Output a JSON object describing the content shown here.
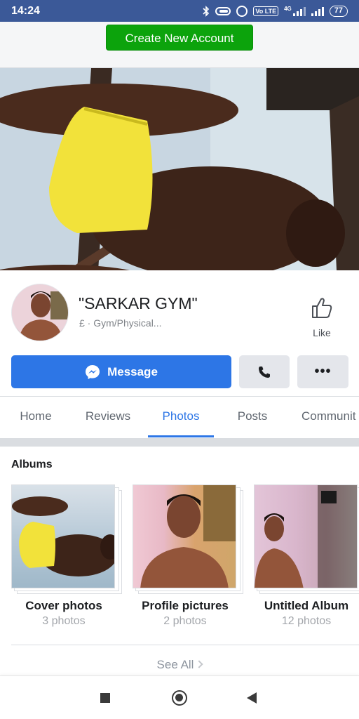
{
  "status_bar": {
    "time": "14:24",
    "network_label": "4G",
    "volte_label": "Vo LTE",
    "battery": "77"
  },
  "header": {
    "create_account_label": "Create New Account",
    "accent_color": "#0ca30c"
  },
  "profile": {
    "name": "\"SARKAR GYM\"",
    "category": "£ · Gym/Physical...",
    "like_label": "Like"
  },
  "actions": {
    "message_label": "Message",
    "call_icon": "phone-icon",
    "more_icon": "more-icon",
    "more_label": "•••",
    "primary_color": "#2d76e6"
  },
  "tabs": [
    {
      "label": "Home",
      "active": false
    },
    {
      "label": "Reviews",
      "active": false
    },
    {
      "label": "Photos",
      "active": true
    },
    {
      "label": "Posts",
      "active": false
    },
    {
      "label": "Communit",
      "active": false
    }
  ],
  "albums": {
    "title": "Albums",
    "items": [
      {
        "name": "Cover photos",
        "count": "3 photos"
      },
      {
        "name": "Profile pictures",
        "count": "2 photos"
      },
      {
        "name": "Untitled Album",
        "count": "12 photos"
      }
    ],
    "see_all_label": "See All"
  },
  "navbar": {
    "icons": [
      "recent-apps-icon",
      "home-icon",
      "back-icon"
    ]
  }
}
